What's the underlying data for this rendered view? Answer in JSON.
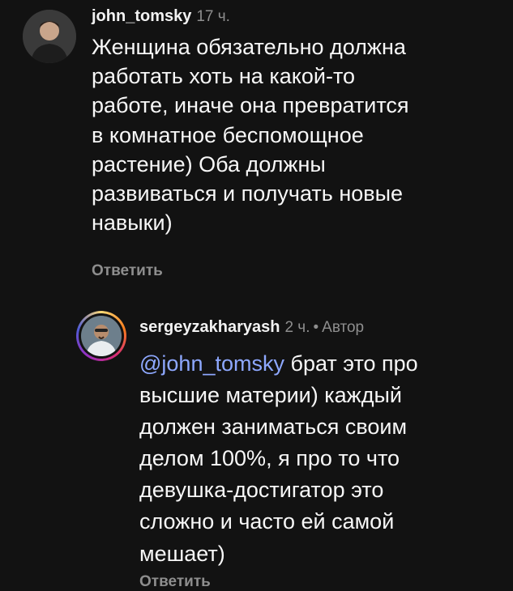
{
  "comments": [
    {
      "username": "john_tomsky",
      "time": "17 ч.",
      "text": "Женщина обязательно должна\nработать хоть на какой-то\nработе, иначе она превратится\nв комнатное беспомощное\nрастение) Оба должны\nразвиваться и получать новые\nнавыки)",
      "reply_label": "Ответить"
    },
    {
      "username": "sergeyzakharyash",
      "time": "2 ч.",
      "separator": "•",
      "author_badge": "Автор",
      "mention": "@john_tomsky",
      "text": " брат это про\nвысшие материи) каждый\nдолжен заниматься своим\nделом 100%, я про то что\nдевушка-достигатор это\nсложно и часто ей самой\nмешает)",
      "reply_label": "Ответить"
    }
  ],
  "colors": {
    "background": "#121212",
    "text": "#f7f7f7",
    "muted": "#8e8e8e",
    "mention": "#8ea8ff"
  },
  "icons": {
    "avatar_1": "user-avatar-photo",
    "avatar_2": "user-avatar-photo-with-story-ring"
  }
}
